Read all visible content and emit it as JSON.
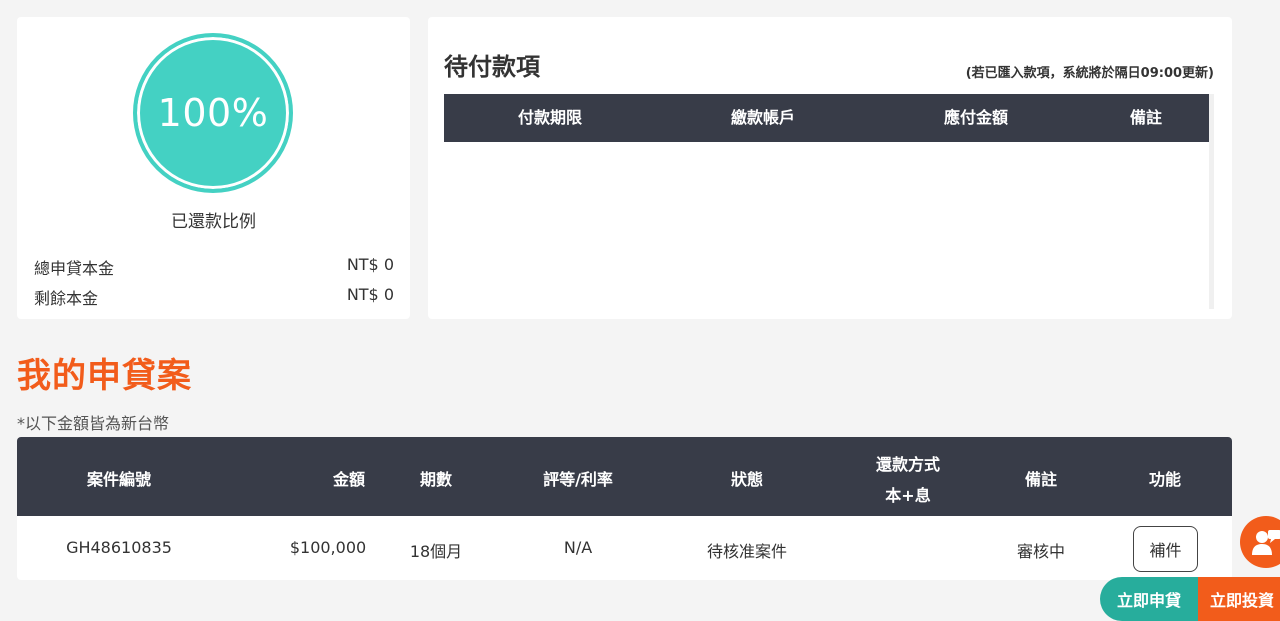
{
  "colors": {
    "ring": "#44d1c3",
    "accent": "#f25c1b",
    "header_bg": "#383c48",
    "apply_button": "#27ad9c"
  },
  "repayment": {
    "percent_text": "100%",
    "percent_value": 100,
    "label": "已還款比例",
    "rows": [
      {
        "label": "總申貸本金",
        "value": "NT$ 0"
      },
      {
        "label": "剩餘本金",
        "value": "NT$ 0"
      }
    ]
  },
  "pending": {
    "title": "待付款項",
    "note_prefix": "(若已匯入款項，系統將於隔日",
    "note_time": "09:00",
    "note_suffix": "更新)",
    "columns": [
      "付款期限",
      "繳款帳戶",
      "應付金額",
      "備註"
    ]
  },
  "loans": {
    "title": "我的申貸案",
    "note": "*以下金額皆為新台幣",
    "columns": {
      "case_no": "案件編號",
      "amount": "金額",
      "periods": "期數",
      "rating": "評等/利率",
      "status": "狀態",
      "repay_line1": "還款方式",
      "repay_line2": "本+息",
      "remark": "備註",
      "action": "功能"
    },
    "rows": [
      {
        "case_no": "GH48610835",
        "amount": "$100,000",
        "periods": "18個月",
        "rating": "N/A",
        "status": "待核准案件",
        "repay": "",
        "remark": "審核中",
        "action_label": "補件"
      }
    ]
  },
  "floating": {
    "icon": "customer-service-icon",
    "apply_label": "立即申貸",
    "invest_label": "立即投資"
  }
}
